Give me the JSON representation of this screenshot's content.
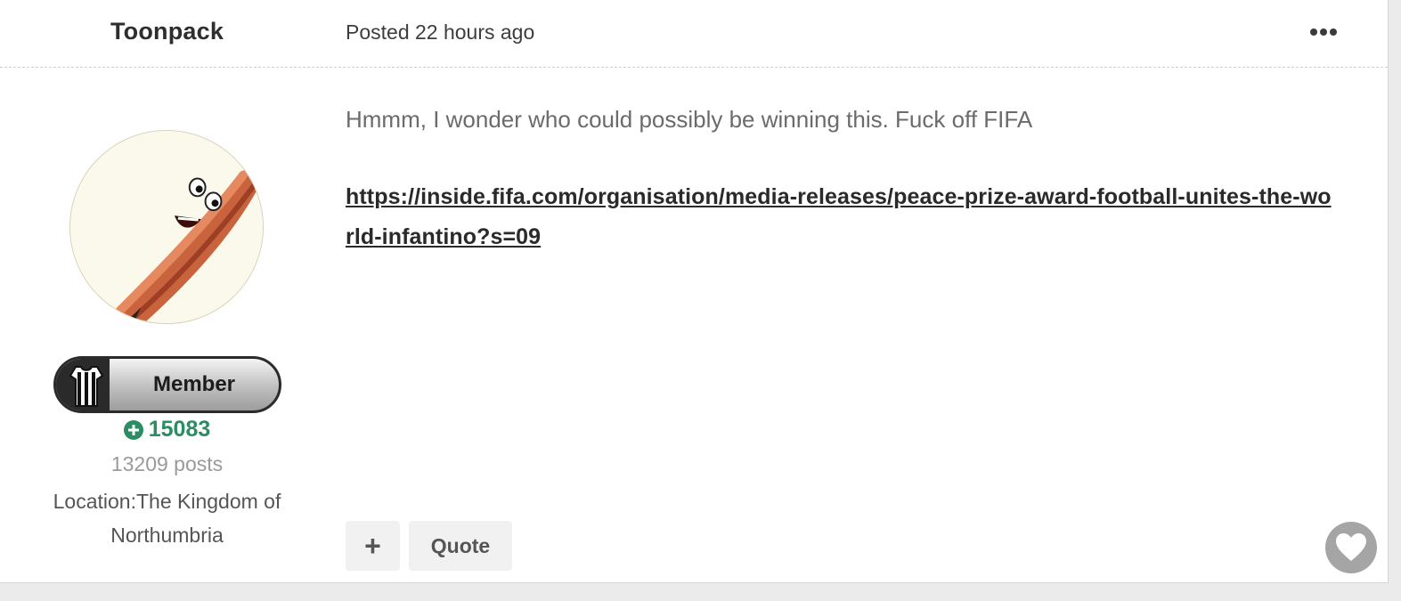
{
  "post": {
    "author": "Toonpack",
    "posted": "Posted 22 hours ago",
    "body_text": "Hmmm, I wonder who could possibly be winning this. Fuck off FIFA",
    "link": "https://inside.fifa.com/organisation/media-releases/peace-prize-award-football-unites-the-world-infantino?s=09"
  },
  "author_panel": {
    "rank": "Member",
    "reputation": "15083",
    "posts": "13209 posts",
    "location": "Location:The Kingdom of Northumbria"
  },
  "actions": {
    "plus_label": "+",
    "quote_label": "Quote"
  },
  "icons": {
    "more": "more-options-icon",
    "reputation": "plus-circle-icon",
    "like": "heart-icon",
    "rank": "striped-shirt-icon"
  },
  "colors": {
    "reputation": "#2c8c63",
    "link": "#2a2a2a",
    "like_button": "#a5a5a5"
  }
}
